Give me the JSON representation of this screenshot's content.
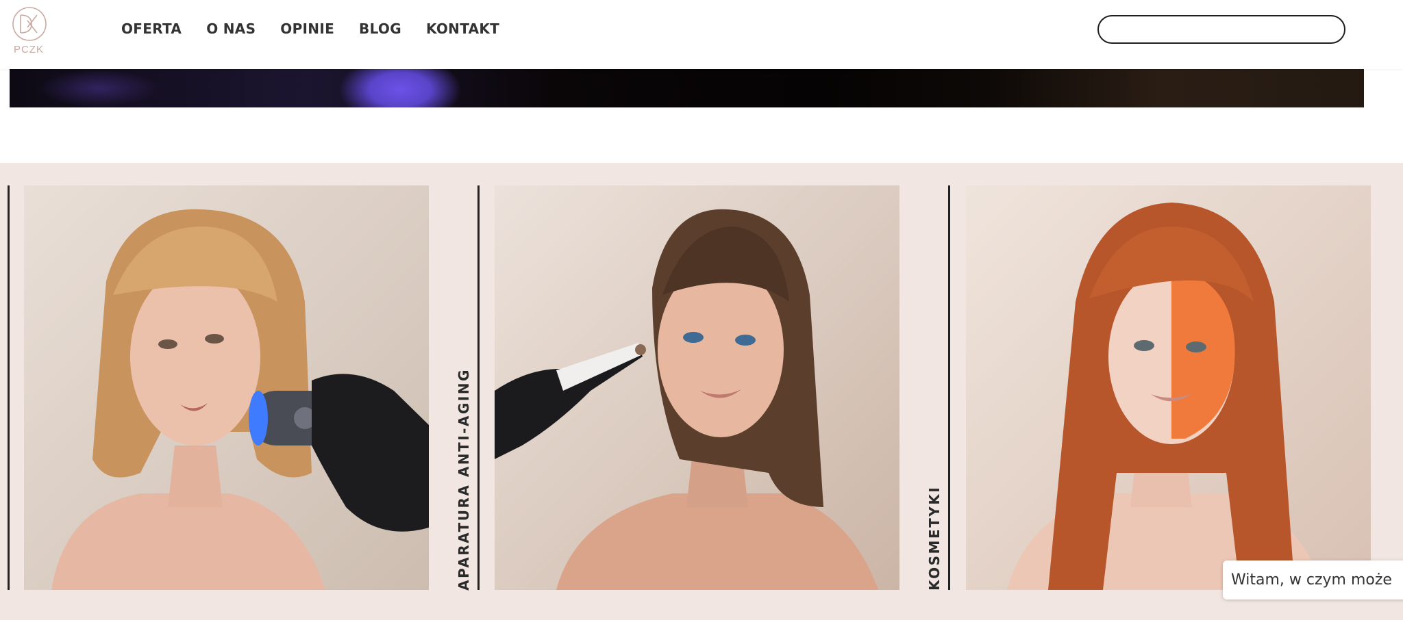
{
  "header": {
    "logo_text": "PCZK",
    "nav": [
      "OFERTA",
      "O NAS",
      "OPINIE",
      "BLOG",
      "KONTAKT"
    ],
    "search": {
      "value": "",
      "placeholder": ""
    }
  },
  "categories": [
    {
      "label": "APARATURA ANTI-AGING"
    },
    {
      "label": "KOSMETYKI"
    }
  ],
  "chat": {
    "text": "Witam, w czym może"
  },
  "colors": {
    "section_bg": "#f1e6e2",
    "accent": "#c9a9a2",
    "text": "#333333"
  }
}
